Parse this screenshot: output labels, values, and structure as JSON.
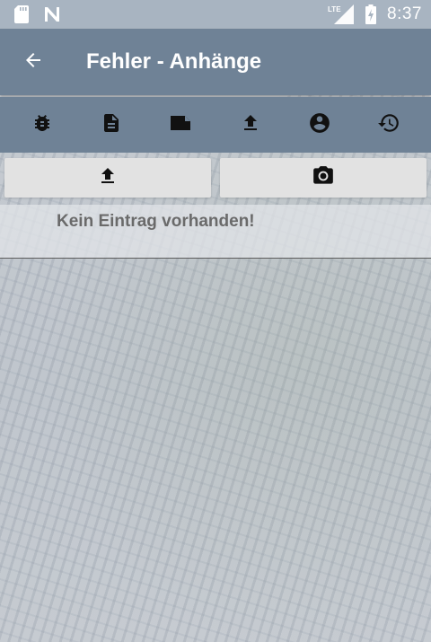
{
  "status_bar": {
    "time": "8:37",
    "network_label": "LTE",
    "icons": [
      "sd-card-icon",
      "n-notification-icon",
      "signal-icon",
      "battery-charging-icon"
    ]
  },
  "app_bar": {
    "title": "Fehler - Anhänge",
    "back_icon": "arrow-back-icon"
  },
  "toolbar": {
    "items": [
      {
        "icon": "bug-icon"
      },
      {
        "icon": "document-icon"
      },
      {
        "icon": "note-icon"
      },
      {
        "icon": "upload-icon"
      },
      {
        "icon": "account-circle-icon"
      },
      {
        "icon": "history-icon"
      }
    ]
  },
  "actions": {
    "upload_icon": "upload-icon",
    "camera_icon": "camera-icon"
  },
  "list": {
    "empty_message": "Kein Eintrag vorhanden!"
  },
  "colors": {
    "status_bar": "#a8b4c1",
    "app_bar": "#6f8296",
    "button_bg": "#e2e2e2",
    "empty_text": "#6a6a6a"
  }
}
